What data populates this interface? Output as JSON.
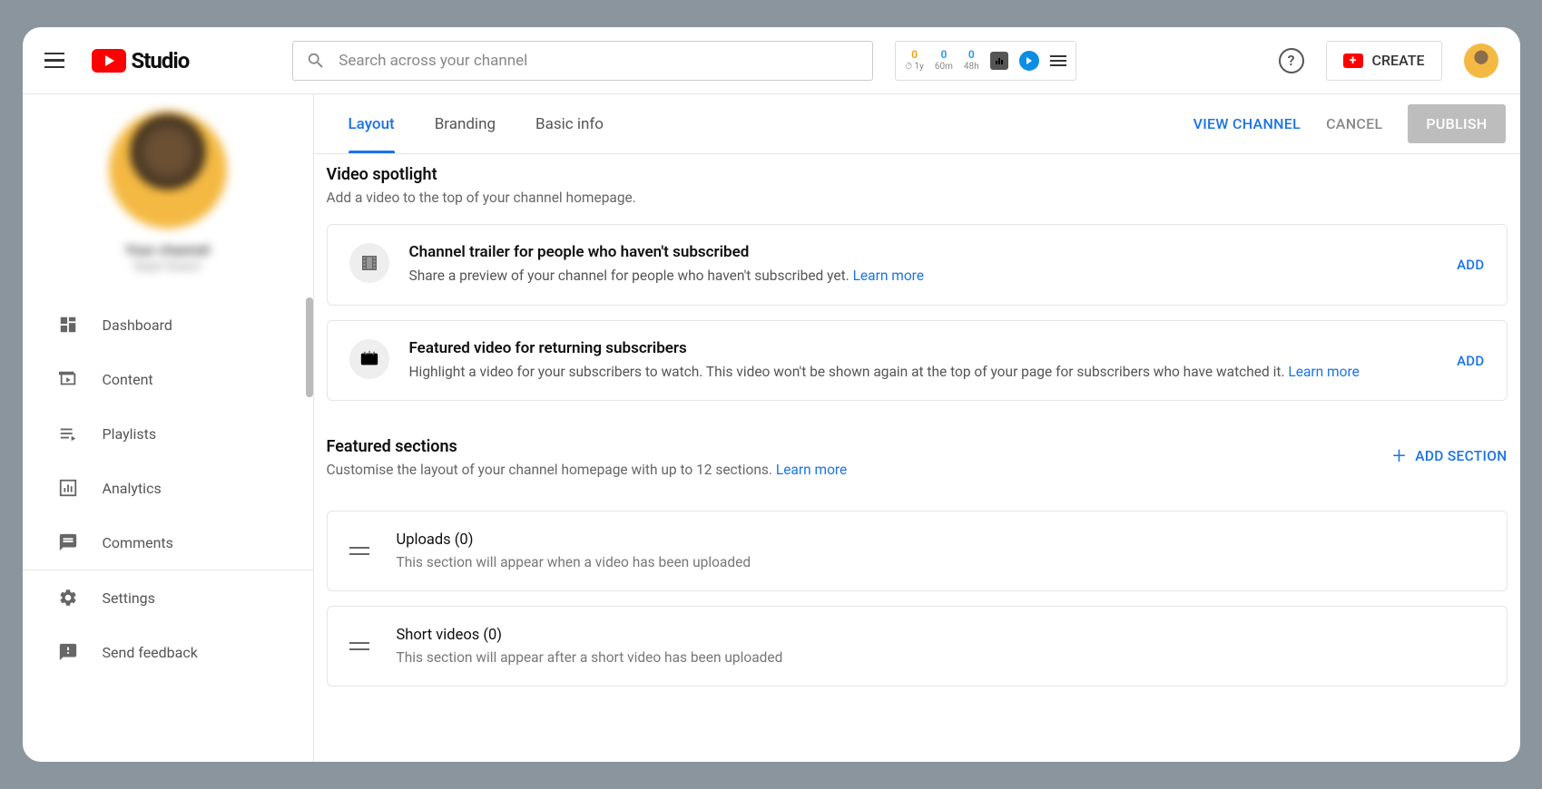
{
  "header": {
    "logo_text": "Studio",
    "search_placeholder": "Search across your channel",
    "stats": [
      {
        "n": "0",
        "t": "1y"
      },
      {
        "n": "0",
        "t": "60m"
      },
      {
        "n": "0",
        "t": "48h"
      }
    ],
    "help": "?",
    "create": "CREATE"
  },
  "sidebar": {
    "profile": {
      "title": "Your channel",
      "subtitle": "Ralph Robert"
    },
    "items": [
      {
        "label": "Dashboard"
      },
      {
        "label": "Content"
      },
      {
        "label": "Playlists"
      },
      {
        "label": "Analytics"
      },
      {
        "label": "Comments"
      },
      {
        "label": "Settings"
      },
      {
        "label": "Send feedback"
      }
    ]
  },
  "tabs": {
    "layout": "Layout",
    "branding": "Branding",
    "basic": "Basic info"
  },
  "actions": {
    "view": "VIEW CHANNEL",
    "cancel": "CANCEL",
    "publish": "PUBLISH"
  },
  "spotlight": {
    "title": "Video spotlight",
    "desc": "Add a video to the top of your channel homepage.",
    "card1": {
      "title": "Channel trailer for people who haven't subscribed",
      "text": "Share a preview of your channel for people who haven't subscribed yet.  ",
      "learn": "Learn more",
      "add": "ADD"
    },
    "card2": {
      "title": "Featured video for returning subscribers",
      "text": "Highlight a video for your subscribers to watch. This video won't be shown again at the top of your page for subscribers who have watched it.  ",
      "learn": "Learn more",
      "add": "ADD"
    }
  },
  "featured": {
    "title": "Featured sections",
    "desc": "Customise the layout of your channel homepage with up to 12 sections. ",
    "learn": "Learn more",
    "add": "ADD SECTION",
    "items": [
      {
        "title": "Uploads (0)",
        "desc": "This section will appear when a video has been uploaded"
      },
      {
        "title": "Short videos (0)",
        "desc": "This section will appear after a short video has been uploaded"
      }
    ]
  }
}
